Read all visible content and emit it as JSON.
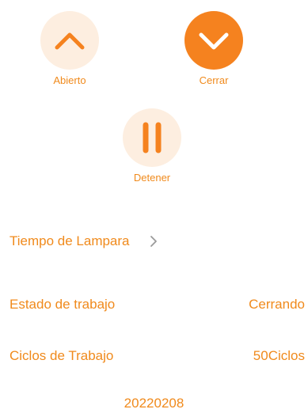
{
  "colors": {
    "accent": "#f5821f",
    "accent_light_bg": "#fdeee0",
    "text": "#f08a1c",
    "chevron": "#9a9a9a"
  },
  "controls": {
    "open": {
      "label": "Abierto",
      "icon": "chevron-up-icon"
    },
    "close": {
      "label": "Cerrar",
      "icon": "chevron-down-icon"
    },
    "stop": {
      "label": "Detener",
      "icon": "pause-icon"
    }
  },
  "lamp": {
    "label": "Tiempo de Lampara",
    "icon": "chevron-right-icon"
  },
  "status": {
    "state_label": "Estado de trabajo",
    "state_value": "Cerrando",
    "cycles_label": "Ciclos de Trabajo",
    "cycles_value": "50Ciclos"
  },
  "footer": {
    "code": "20220208"
  }
}
